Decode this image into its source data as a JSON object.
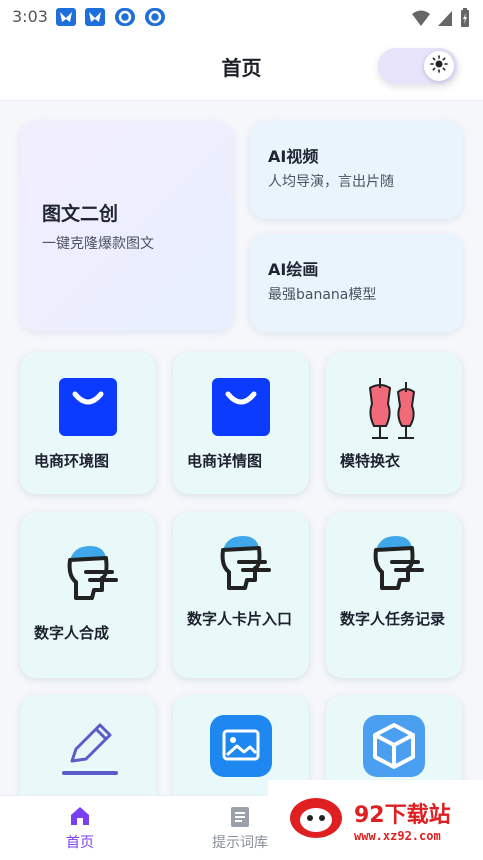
{
  "status": {
    "time": "3:03",
    "accent": "#1e6fd9"
  },
  "header": {
    "title": "首页",
    "theme_icon": "sun-icon"
  },
  "feature_cards": {
    "main": {
      "title": "图文二创",
      "subtitle": "一键克隆爆款图文"
    },
    "video": {
      "title": "AI视频",
      "subtitle": "人均导演，言出片随"
    },
    "drawing": {
      "title": "AI绘画",
      "subtitle": "最强banana模型"
    }
  },
  "tools": [
    {
      "label": "电商环境图",
      "icon": "shopping-bag-icon"
    },
    {
      "label": "电商详情图",
      "icon": "shopping-bag-icon"
    },
    {
      "label": "模特换衣",
      "icon": "mannequin-icon"
    },
    {
      "label": "数字人合成",
      "icon": "digital-human-icon"
    },
    {
      "label": "数字人卡片入口",
      "icon": "digital-human-icon"
    },
    {
      "label": "数字人任务记录",
      "icon": "digital-human-icon"
    },
    {
      "label": "",
      "icon": "pencil-icon"
    },
    {
      "label": "",
      "icon": "image-icon"
    },
    {
      "label": "",
      "icon": "cube-icon"
    }
  ],
  "tabbar": {
    "home": "首页",
    "prompts": "提示词库",
    "active_color": "#7b3ff2"
  },
  "watermark": {
    "title": "92下载站",
    "site": "www.xz92.com"
  }
}
